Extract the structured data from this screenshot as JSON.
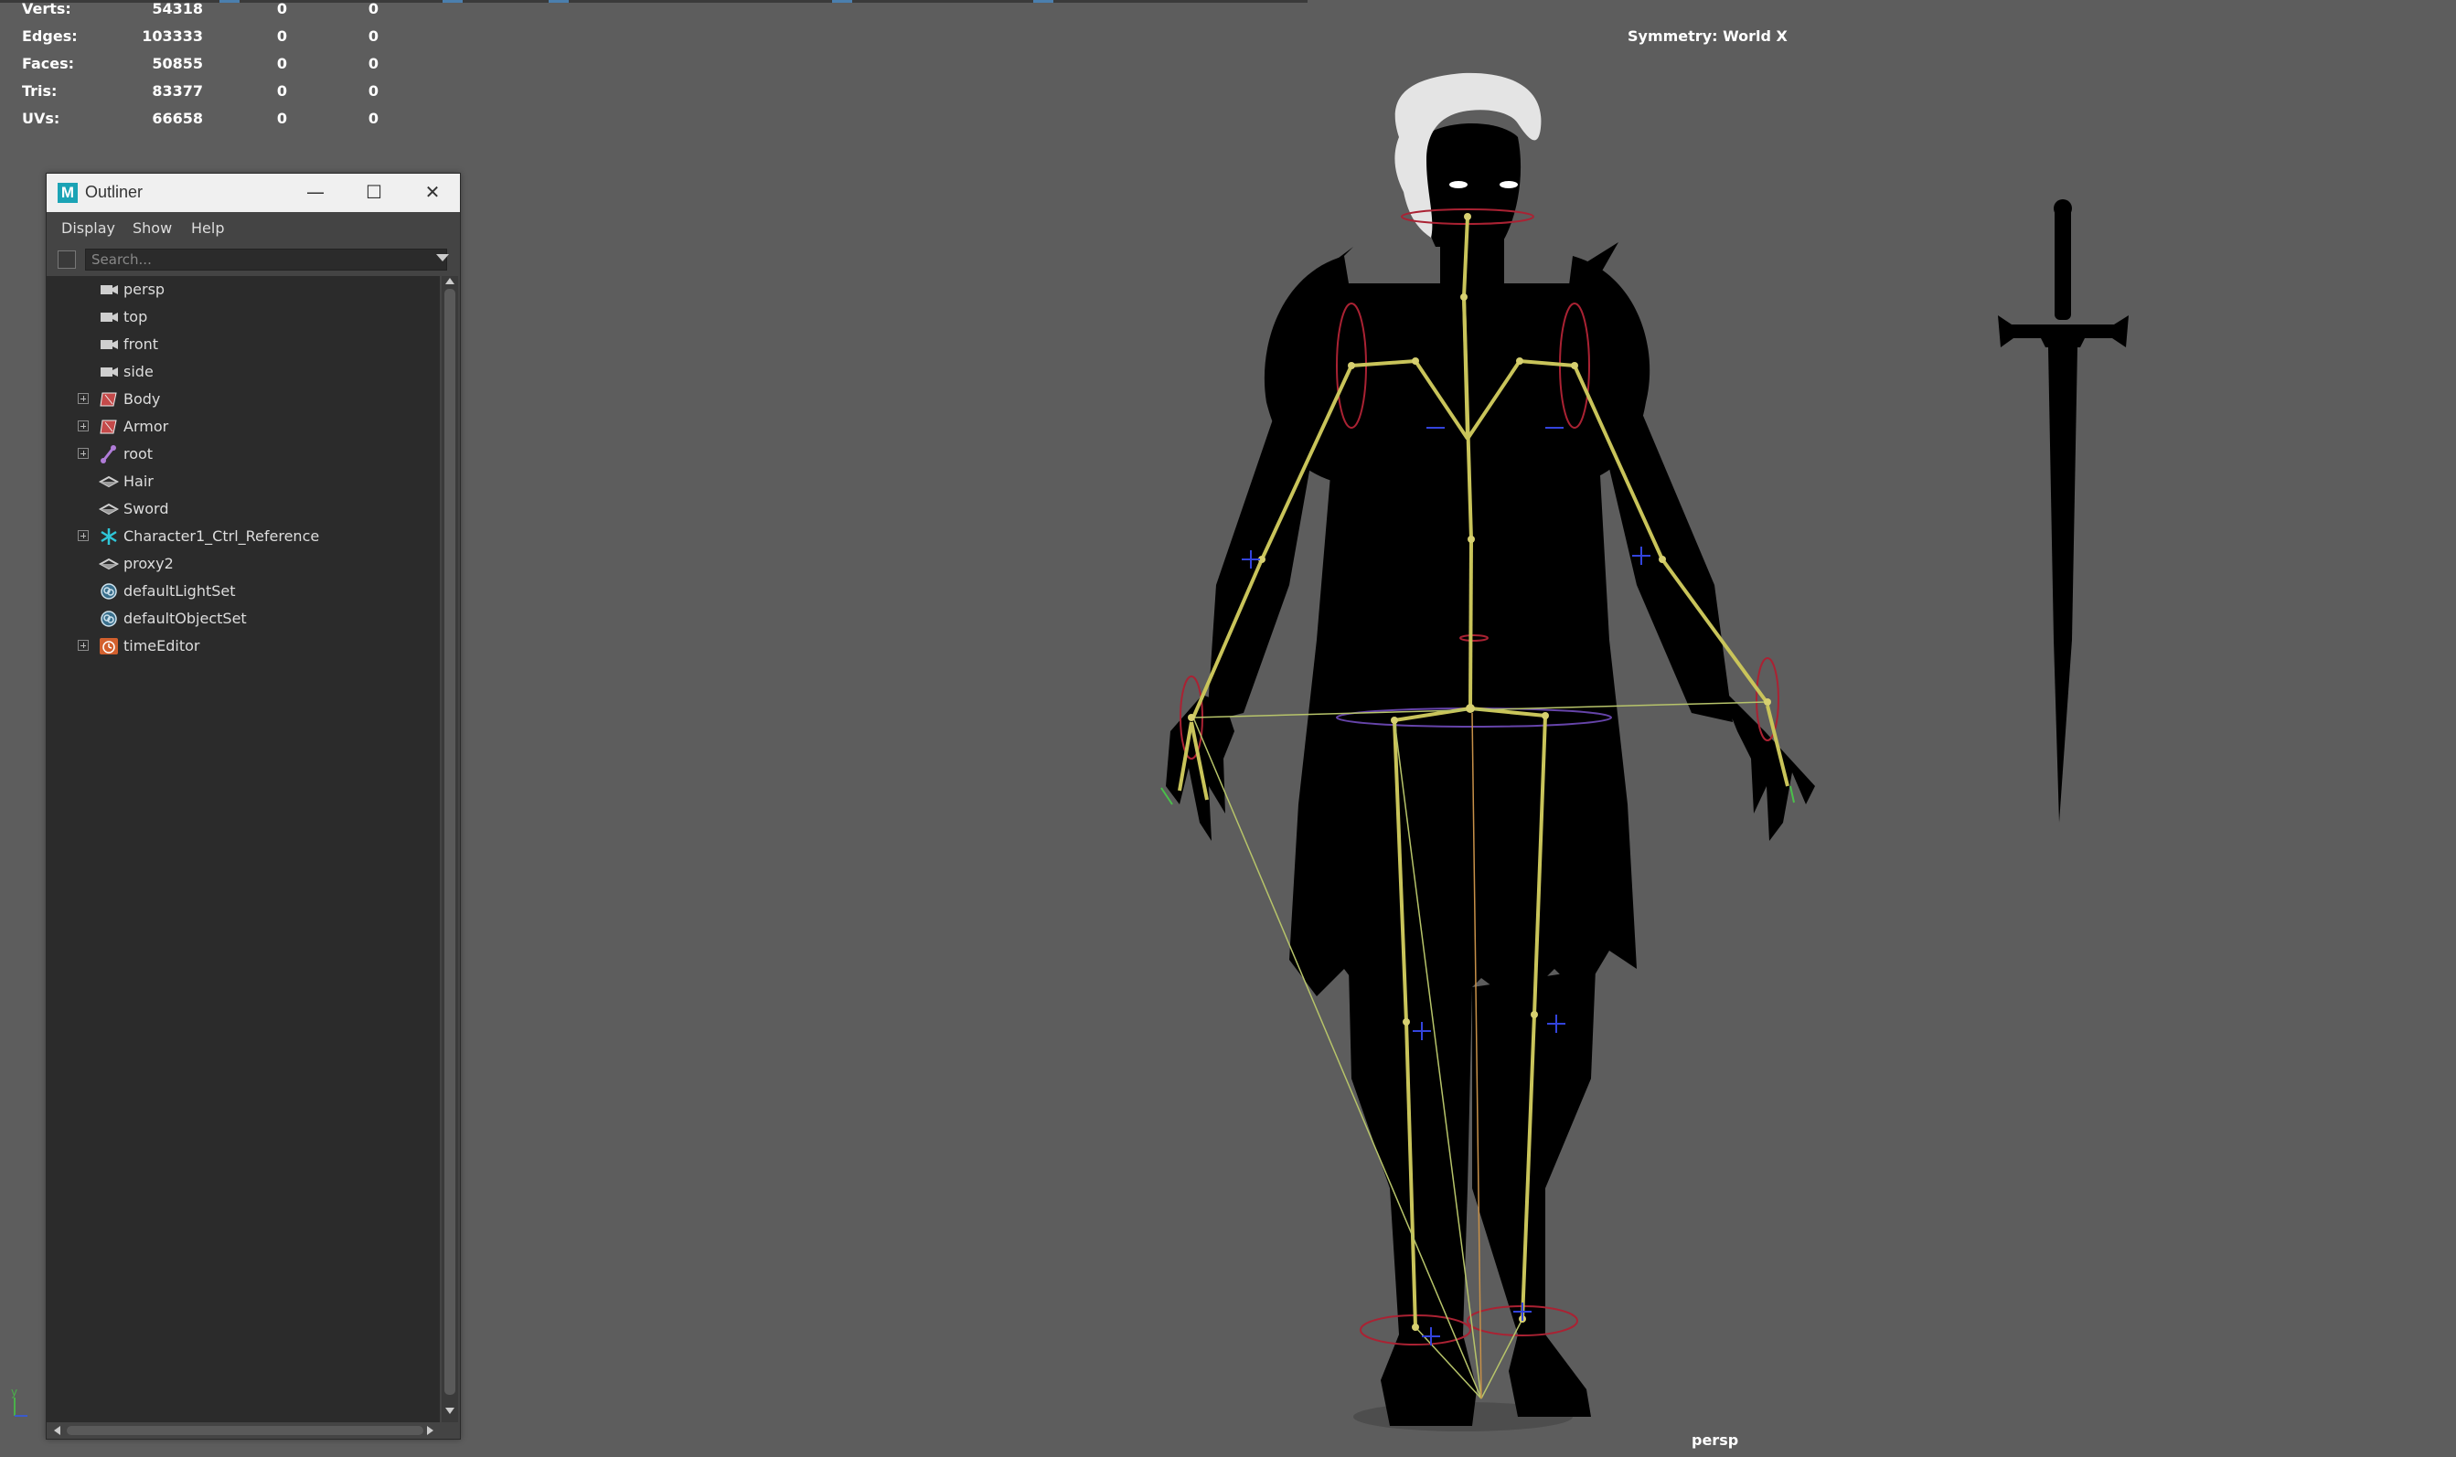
{
  "hud": {
    "rows": [
      {
        "label": "Verts:",
        "v1": "54318",
        "v2": "0",
        "v3": "0"
      },
      {
        "label": "Edges:",
        "v1": "103333",
        "v2": "0",
        "v3": "0"
      },
      {
        "label": "Faces:",
        "v1": "50855",
        "v2": "0",
        "v3": "0"
      },
      {
        "label": "Tris:",
        "v1": "83377",
        "v2": "0",
        "v3": "0"
      },
      {
        "label": "UVs:",
        "v1": "66658",
        "v2": "0",
        "v3": "0"
      }
    ]
  },
  "viewport": {
    "symmetry": "Symmetry: World X",
    "camera": "persp",
    "axis_label": "y"
  },
  "outliner": {
    "title": "Outliner",
    "logo": "M",
    "window_buttons": {
      "minimize": "—",
      "maximize": "☐",
      "close": "✕"
    },
    "menu": [
      "Display",
      "Show",
      "Help"
    ],
    "search_placeholder": "Search...",
    "items": [
      {
        "label": "persp",
        "icon": "camera-icon",
        "expandable": false
      },
      {
        "label": "top",
        "icon": "camera-icon",
        "expandable": false
      },
      {
        "label": "front",
        "icon": "camera-icon",
        "expandable": false
      },
      {
        "label": "side",
        "icon": "camera-icon",
        "expandable": false
      },
      {
        "label": "Body",
        "icon": "mesh-group-icon",
        "expandable": true
      },
      {
        "label": "Armor",
        "icon": "mesh-group-icon",
        "expandable": true
      },
      {
        "label": "root",
        "icon": "joint-icon",
        "expandable": true
      },
      {
        "label": "Hair",
        "icon": "transform-icon",
        "expandable": false
      },
      {
        "label": "Sword",
        "icon": "transform-icon",
        "expandable": false
      },
      {
        "label": "Character1_Ctrl_Reference",
        "icon": "hik-reference-icon",
        "expandable": true
      },
      {
        "label": "proxy2",
        "icon": "transform-icon",
        "expandable": false
      },
      {
        "label": "defaultLightSet",
        "icon": "set-icon",
        "expandable": false
      },
      {
        "label": "defaultObjectSet",
        "icon": "set-icon",
        "expandable": false
      },
      {
        "label": "timeEditor",
        "icon": "time-editor-icon",
        "expandable": true
      }
    ]
  }
}
